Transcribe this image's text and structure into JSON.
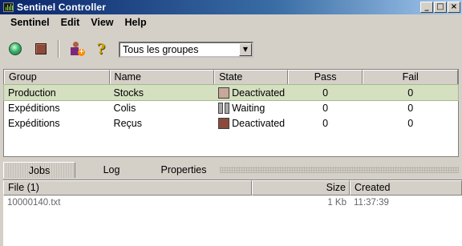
{
  "window": {
    "title": "Sentinel Controller",
    "controls": [
      "_",
      "□",
      "×"
    ]
  },
  "menu": [
    "Sentinel",
    "Edit",
    "View",
    "Help"
  ],
  "toolbar": {
    "icons": [
      "play-icon",
      "stop-icon",
      "add-user-icon",
      "help-icon"
    ],
    "help_glyph": "?",
    "group_select": {
      "value": "Tous les groupes",
      "arrow": "▼"
    }
  },
  "groups_table": {
    "columns": [
      "Group",
      "Name",
      "State",
      "Pass",
      "Fail"
    ],
    "rows": [
      {
        "group": "Production",
        "name": "Stocks",
        "state": "Deactivated",
        "state_color": "#c8a898",
        "pass": "0",
        "fail": "0",
        "selected": true
      },
      {
        "group": "Expéditions",
        "name": "Colis",
        "state": "Waiting",
        "state_color": "#a8a8a8",
        "pass": "0",
        "fail": "0",
        "selected": false
      },
      {
        "group": "Expéditions",
        "name": "Reçus",
        "state": "Deactivated",
        "state_color": "#8b4a3c",
        "pass": "0",
        "fail": "0",
        "selected": false
      }
    ]
  },
  "tabs": [
    "Jobs",
    "Log",
    "Properties"
  ],
  "files_table": {
    "columns": [
      "File (1)",
      "Size",
      "Created"
    ],
    "rows": [
      {
        "file": "10000140.txt",
        "size": "1 Kb",
        "created": "11:37:39"
      }
    ]
  },
  "colors": {
    "selected_row": "#d4e0c0",
    "titlebar": "#0a246a"
  }
}
